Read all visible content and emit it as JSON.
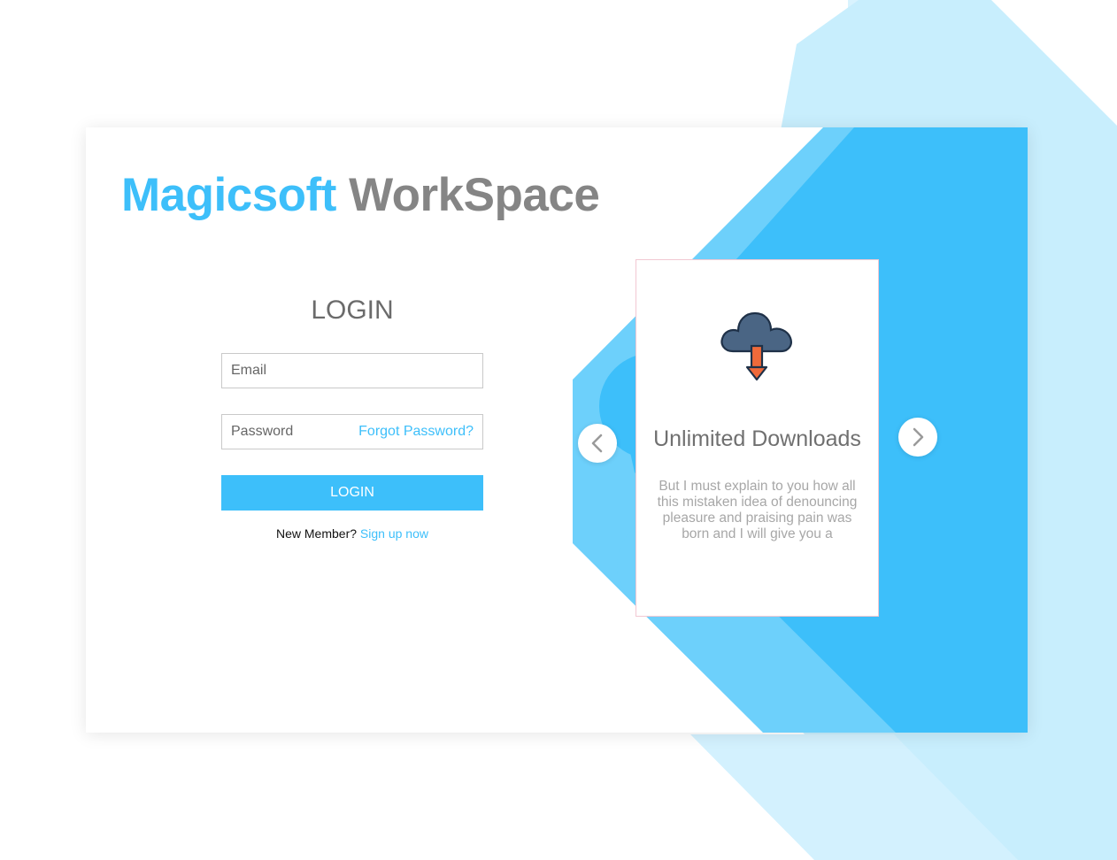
{
  "brand": {
    "part1": "Magicsoft",
    "part2": "WorkSpace"
  },
  "login": {
    "title": "LOGIN",
    "email_placeholder": "Email",
    "password_placeholder": "Password",
    "forgot_label": "Forgot Password?",
    "button_label": "LOGIN",
    "new_member_text": "New Member?",
    "signup_label": "Sign up now"
  },
  "feature": {
    "icon": "cloud-download-icon",
    "title": "Unlimited Downloads",
    "description": "But I must explain to you how all this mistaken idea of denouncing pleasure and praising pain was born and I will give you a"
  },
  "carousel": {
    "prev_icon": "chevron-left-icon",
    "next_icon": "chevron-right-icon"
  },
  "colors": {
    "accent": "#3dbffa",
    "brand_gray": "#858585",
    "light_blue": "#c8eefd",
    "mid_blue": "#6dd0fb"
  }
}
